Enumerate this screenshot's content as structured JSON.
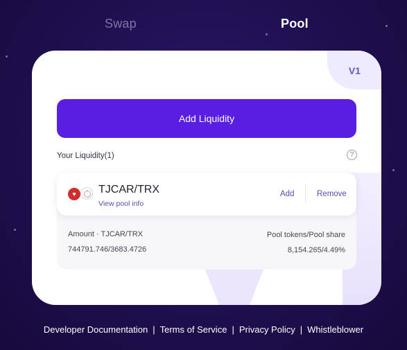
{
  "tabs": [
    {
      "label": "Swap",
      "active": false
    },
    {
      "label": "Pool",
      "active": true
    }
  ],
  "version_badge": "V1",
  "add_liquidity_label": "Add Liquidity",
  "your_liquidity_label": "Your Liquidity(1)",
  "help_icon": "question-circle-icon",
  "position": {
    "pair": "TJCAR/TRX",
    "view_info": "View pool info",
    "add_label": "Add",
    "remove_label": "Remove",
    "amount_label": "Amount · TJCAR/TRX",
    "amount_value": "744791.746/3683.4726",
    "share_label": "Pool tokens/Pool share",
    "share_value": "8,154.265/4.49%"
  },
  "footer": [
    "Developer Documentation",
    "Terms of Service",
    "Privacy Policy",
    "Whistleblower"
  ],
  "colors": {
    "background": "#1f0f4f",
    "accent": "#5a1ee3",
    "link": "#5a4bb0",
    "card": "#ffffff"
  }
}
